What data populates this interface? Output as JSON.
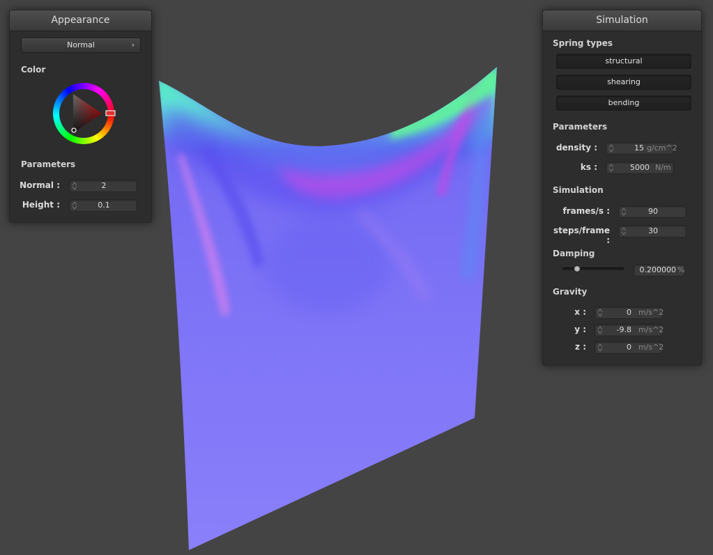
{
  "appearance": {
    "title": "Appearance",
    "shader_dropdown": "Normal",
    "color_label": "Color",
    "parameters_label": "Parameters",
    "normal_label": "Normal :",
    "normal_value": "2",
    "height_label": "Height :",
    "height_value": "0.1"
  },
  "simulation": {
    "title": "Simulation",
    "spring_types_label": "Spring types",
    "spring_buttons": [
      "structural",
      "shearing",
      "bending"
    ],
    "parameters_label": "Parameters",
    "density_label": "density :",
    "density_value": "15",
    "density_unit": "g/cm^2",
    "ks_label": "ks :",
    "ks_value": "5000",
    "ks_unit": "N/m",
    "simulation_label": "Simulation",
    "fps_label": "frames/s :",
    "fps_value": "90",
    "steps_label": "steps/frame :",
    "steps_value": "30",
    "damping_label": "Damping",
    "damping_value": "0.200000",
    "damping_unit": "%",
    "damping_fraction": 0.2,
    "gravity_label": "Gravity",
    "gravity_x_label": "x :",
    "gravity_x": "0",
    "gravity_y_label": "y :",
    "gravity_y": "-9.8",
    "gravity_z_label": "z :",
    "gravity_z": "0",
    "gravity_unit": "m/s^2"
  },
  "colors": {
    "background": "#444444",
    "panel": "#2d2d2d",
    "cloth_base": "#8a7cf6",
    "cloth_highlight_green": "#66f2a0",
    "cloth_magenta": "#b04ee8"
  },
  "icons": {
    "dropdown_arrow": "chevron-right-icon",
    "spinner": "spinner-arrows-icon"
  }
}
